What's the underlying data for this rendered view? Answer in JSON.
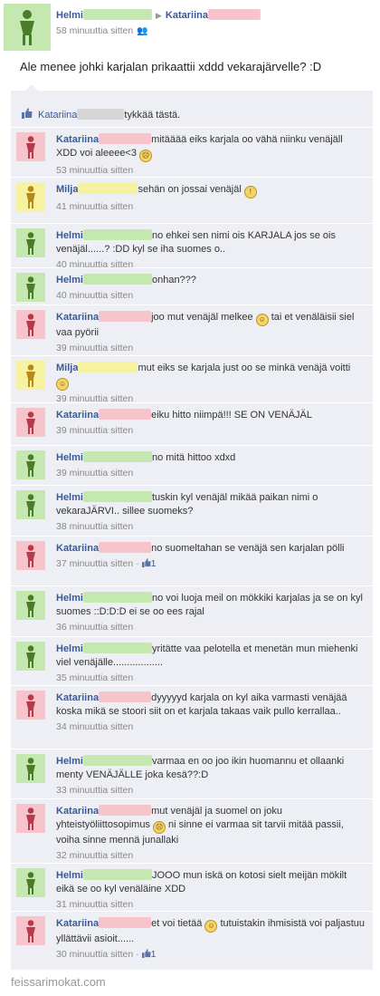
{
  "colors": {
    "male_avatar_green": "#c5e8b0",
    "female_avatar_pink": "#f8c4cc",
    "milja_yellow": "#f7f2a0",
    "link": "#3b5998"
  },
  "post": {
    "author": "Helmi",
    "target": "Katariina",
    "time": "58 minuuttia sitten",
    "text": "Ale menee johki karjalan prikaattii xddd vekarajärvelle? :D"
  },
  "likes": {
    "name": "Katariina",
    "text": "tykkää tästä."
  },
  "comments": [
    {
      "author": "Katariina",
      "color": "p",
      "blur": 58,
      "text": "mitääää eiks karjala oo vähä niinku venäjäll XDD voi aleeee<3",
      "emoji": "frown",
      "time": "53 minuuttia sitten"
    },
    {
      "author": "Milja",
      "color": "y",
      "blur": 66,
      "text": "sehän on jossai venäjäl",
      "emoji": "shock",
      "time": "41 minuuttia sitten"
    },
    {
      "author": "Helmi",
      "color": "g",
      "blur": 76,
      "text": "no ehkei sen nimi ois KARJALA jos se ois venäjäl......? :DD kyl se iha suomes o..",
      "time": "40 minuuttia sitten"
    },
    {
      "author": "Helmi",
      "color": "g",
      "blur": 76,
      "text": "onhan???",
      "time": "40 minuuttia sitten"
    },
    {
      "author": "Katariina",
      "color": "p",
      "blur": 58,
      "text": "joo mut venäjäl melkee",
      "emoji": "smile",
      "text2": "tai et venäläisii siel vaa pyörii",
      "time": "39 minuuttia sitten"
    },
    {
      "author": "Milja",
      "color": "y",
      "blur": 66,
      "text": "mut eiks se karjala just oo se minkä venäjä voitti",
      "emoji": "smile",
      "time": "39 minuuttia sitten"
    },
    {
      "author": "Katariina",
      "color": "p",
      "blur": 58,
      "text": "eiku hitto niimpä!!! SE ON VENÄJÄL",
      "time": "39 minuuttia sitten"
    },
    {
      "author": "Helmi",
      "color": "g",
      "blur": 76,
      "text": "no mitä hittoo xdxd",
      "time": "39 minuuttia sitten"
    },
    {
      "author": "Helmi",
      "color": "g",
      "blur": 76,
      "text": "tuskin kyl venäjäl mikää paikan nimi o vekaraJÄRVI.. sillee suomeks?",
      "time": "38 minuuttia sitten"
    },
    {
      "author": "Katariina",
      "color": "p",
      "blur": 58,
      "text": "no suomeltahan se venäjä sen karjalan pölli",
      "time": "37 minuuttia sitten",
      "likes": "1"
    },
    {
      "author": "Helmi",
      "color": "g",
      "blur": 76,
      "text": "no voi luoja meil on mökkiki karjalas ja se on kyl suomes ::D:D:D ei se oo ees rajal",
      "time": "36 minuuttia sitten"
    },
    {
      "author": "Helmi",
      "color": "g",
      "blur": 76,
      "text": "yritätte vaa pelotella et menetän mun miehenki viel venäjälle..................",
      "time": "35 minuuttia sitten"
    },
    {
      "author": "Katariina",
      "color": "p",
      "blur": 58,
      "text": "dyyyyyd karjala on kyl aika varmasti venäjää koska mikä se stoori siit on et karjala takaas vaik pullo kerrallaa..",
      "time": "34 minuuttia sitten"
    },
    {
      "author": "Helmi",
      "color": "g",
      "blur": 76,
      "text": "varmaa en oo joo ikin huomannu et ollaanki menty VENÄJÄLLE joka kesä??:D",
      "time": "33 minuuttia sitten"
    },
    {
      "author": "Katariina",
      "color": "p",
      "blur": 58,
      "text": "mut venäjäl ja suomel on joku yhteistyöliittosopimus",
      "emoji": "frown",
      "text2": "ni sinne ei varmaa sit tarvii mitää passii, voiha sinne mennä junallaki",
      "time": "32 minuuttia sitten"
    },
    {
      "author": "Helmi",
      "color": "g",
      "blur": 76,
      "text": "JOOO mun iskä on kotosi sielt meijän mökilt eikä se oo kyl venäläine XDD",
      "time": "31 minuuttia sitten"
    },
    {
      "author": "Katariina",
      "color": "p",
      "blur": 58,
      "text": "et voi tietää",
      "emoji": "smile",
      "text2": "tutuistakin ihmisistä voi paljastuu yllättävii asioit......",
      "time": "30 minuuttia sitten",
      "likes": "1"
    }
  ],
  "watermark": "feissarimokat.com"
}
